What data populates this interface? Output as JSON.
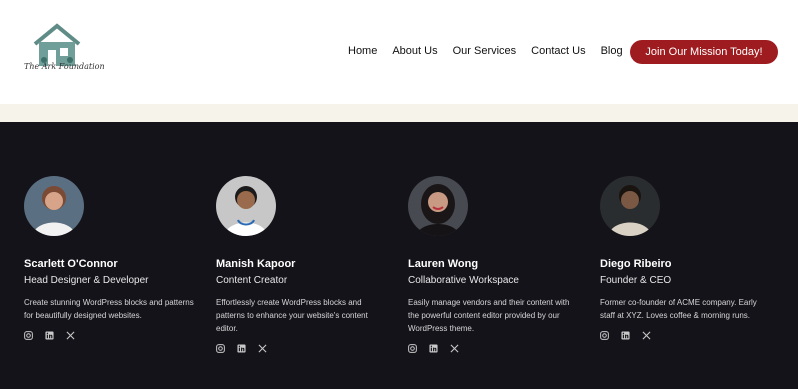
{
  "header": {
    "logo_text": "The Ark Foundation",
    "nav": [
      "Home",
      "About Us",
      "Our Services",
      "Contact Us",
      "Blog"
    ],
    "cta_label": "Join Our Mission Today!"
  },
  "team": [
    {
      "name": "Scarlett O'Connor",
      "role": "Head Designer & Developer",
      "bio": "Create stunning WordPress blocks and patterns for beautifully designed websites.",
      "avatar_bg": "#5b6f83",
      "skin": "#d7a48a",
      "hair": "#7a4a34"
    },
    {
      "name": "Manish Kapoor",
      "role": "Content Creator",
      "bio": "Effortlessly create WordPress blocks and patterns to enhance your website's content editor.",
      "avatar_bg": "#c7c7c7",
      "skin": "#9a6a4c",
      "hair": "#1b1b1b"
    },
    {
      "name": "Lauren Wong",
      "role": "Collaborative Workspace",
      "bio": "Easily manage vendors and their content with the powerful content editor provided by our WordPress theme.",
      "avatar_bg": "#474a50",
      "skin": "#c99a83",
      "hair": "#1a1618"
    },
    {
      "name": "Diego Ribeiro",
      "role": "Founder & CEO",
      "bio": "Former co-founder of ACME company. Early staff at XYZ. Loves coffee & morning runs.",
      "avatar_bg": "#2a2d30",
      "skin": "#7a5844",
      "hair": "#1a1411"
    }
  ],
  "social_icons": [
    "instagram-icon",
    "linkedin-icon",
    "x-icon"
  ],
  "colors": {
    "accent": "#9e1b1f",
    "footer_bg": "#14131a",
    "band": "#f6f3ea"
  }
}
